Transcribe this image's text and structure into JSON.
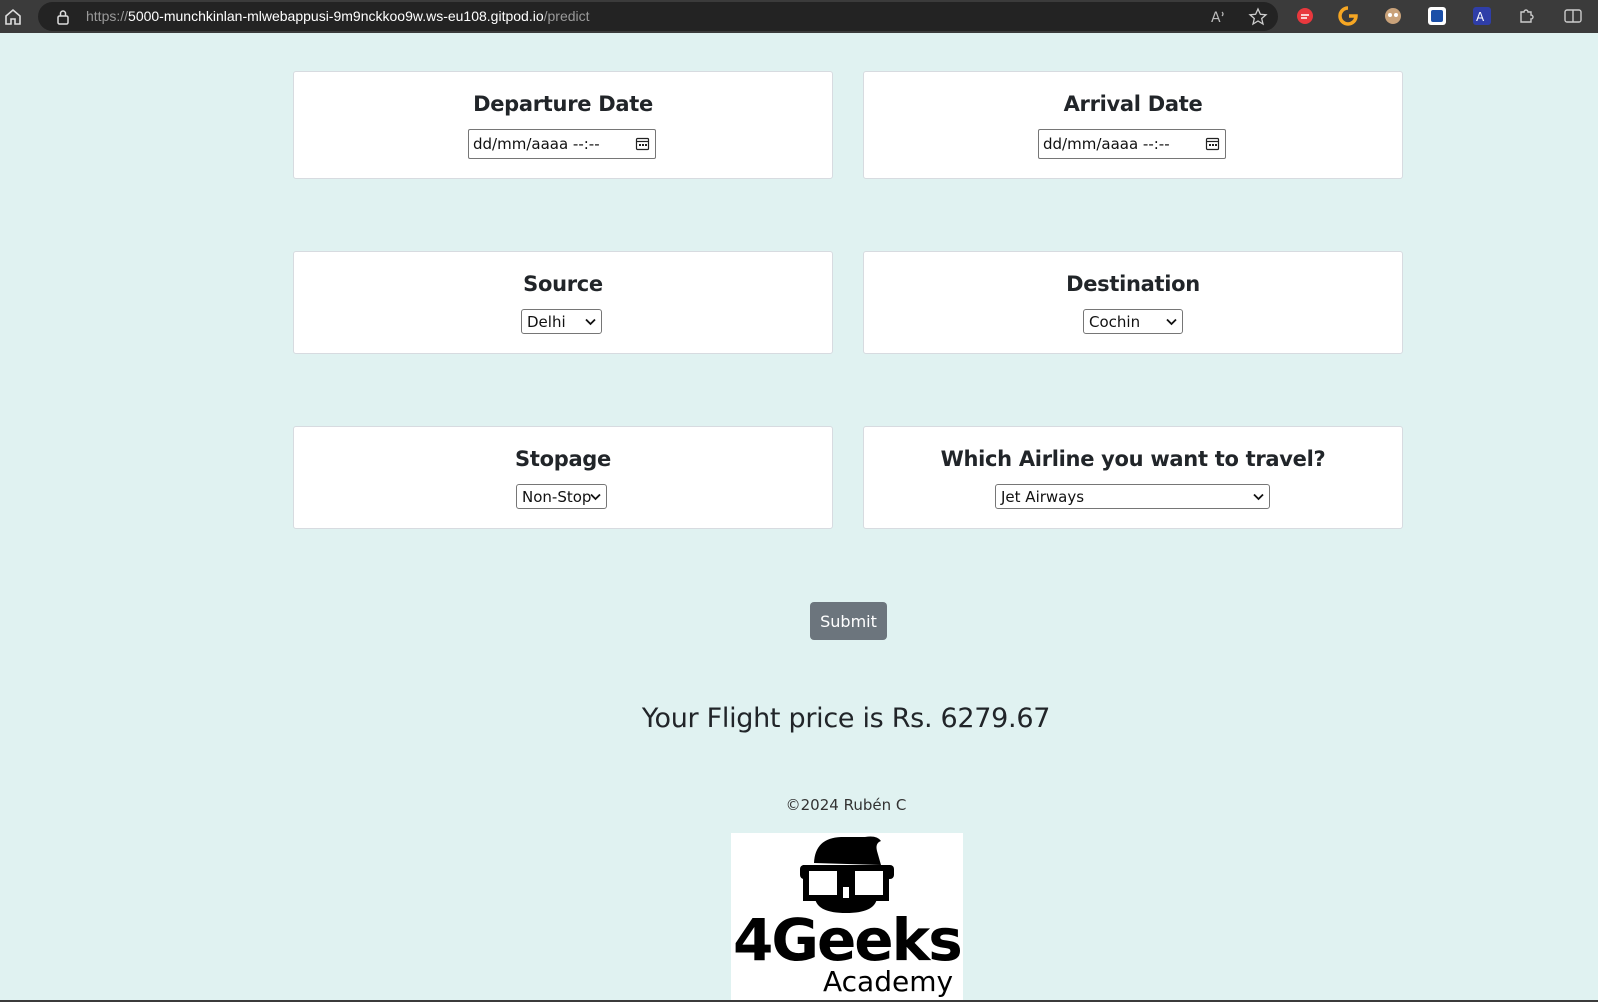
{
  "browser": {
    "url_protocol": "https://",
    "url_host": "5000-munchkinlan-mlwebappusi-9m9nckkoo9w.ws-eu108.gitpod.io",
    "url_path": "/predict"
  },
  "form": {
    "departure": {
      "label": "Departure Date",
      "placeholder": "dd/mm/aaaa  --:--"
    },
    "arrival": {
      "label": "Arrival Date",
      "placeholder": "dd/mm/aaaa  --:--"
    },
    "source": {
      "label": "Source",
      "selected": "Delhi"
    },
    "destination": {
      "label": "Destination",
      "selected": "Cochin"
    },
    "stopage": {
      "label": "Stopage",
      "selected": "Non-Stop"
    },
    "airline": {
      "label": "Which Airline you want to travel?",
      "selected": "Jet Airways"
    },
    "submit_label": "Submit"
  },
  "result": {
    "text": "Your Flight price is Rs. 6279.67"
  },
  "footer": {
    "copyright": "©2024 Rubén C"
  },
  "logo": {
    "line1": "4Geeks",
    "line2": "Academy"
  },
  "colors": {
    "page_bg": "#e0f2f1",
    "button_bg": "#6c757d",
    "chrome_bg": "#3b3b3b"
  }
}
